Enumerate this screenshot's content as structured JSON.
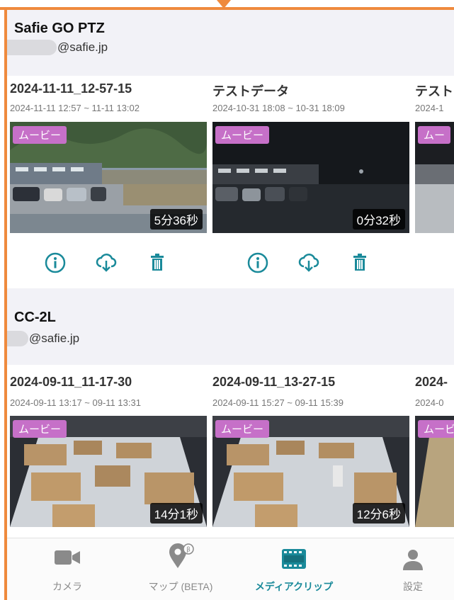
{
  "cameras": [
    {
      "name": "Safie GO PTZ",
      "email": "@safie.jp",
      "clips": [
        {
          "title": "2024-11-11_12-57-15",
          "time_range": "2024-11-11 12:57 ~ 11-11 13:02",
          "badge": "ムービー",
          "duration": "5分36秒"
        },
        {
          "title": "テストデータ",
          "time_range": "2024-10-31 18:08 ~ 10-31 18:09",
          "badge": "ムービー",
          "duration": "0分32秒"
        },
        {
          "title": "テスト",
          "time_range": "2024-1",
          "badge": "ムー",
          "duration": ""
        }
      ]
    },
    {
      "name": "CC-2L",
      "email": "@safie.jp",
      "clips": [
        {
          "title": "2024-09-11_11-17-30",
          "time_range": "2024-09-11 13:17 ~ 09-11 13:31",
          "badge": "ムービー",
          "duration": "14分1秒"
        },
        {
          "title": "2024-09-11_13-27-15",
          "time_range": "2024-09-11 15:27 ~ 09-11 15:39",
          "badge": "ムービー",
          "duration": "12分6秒"
        },
        {
          "title": "2024-",
          "time_range": "2024-0",
          "badge": "ムービ",
          "duration": ""
        }
      ]
    }
  ],
  "actions": {
    "info": "info-icon",
    "download": "cloud-download-icon",
    "delete": "trash-icon"
  },
  "tabs": [
    {
      "label": "カメラ",
      "icon": "video-camera-icon",
      "active": false
    },
    {
      "label": "マップ (BETA)",
      "icon": "map-pin-icon",
      "active": false
    },
    {
      "label": "メディアクリップ",
      "icon": "film-icon",
      "active": true
    },
    {
      "label": "設定",
      "icon": "user-icon",
      "active": false
    }
  ],
  "colors": {
    "accent": "#1a8a9a",
    "badge": "#c670c8",
    "annotation": "#ef8a3d",
    "header_bg": "#f2f2f7"
  }
}
